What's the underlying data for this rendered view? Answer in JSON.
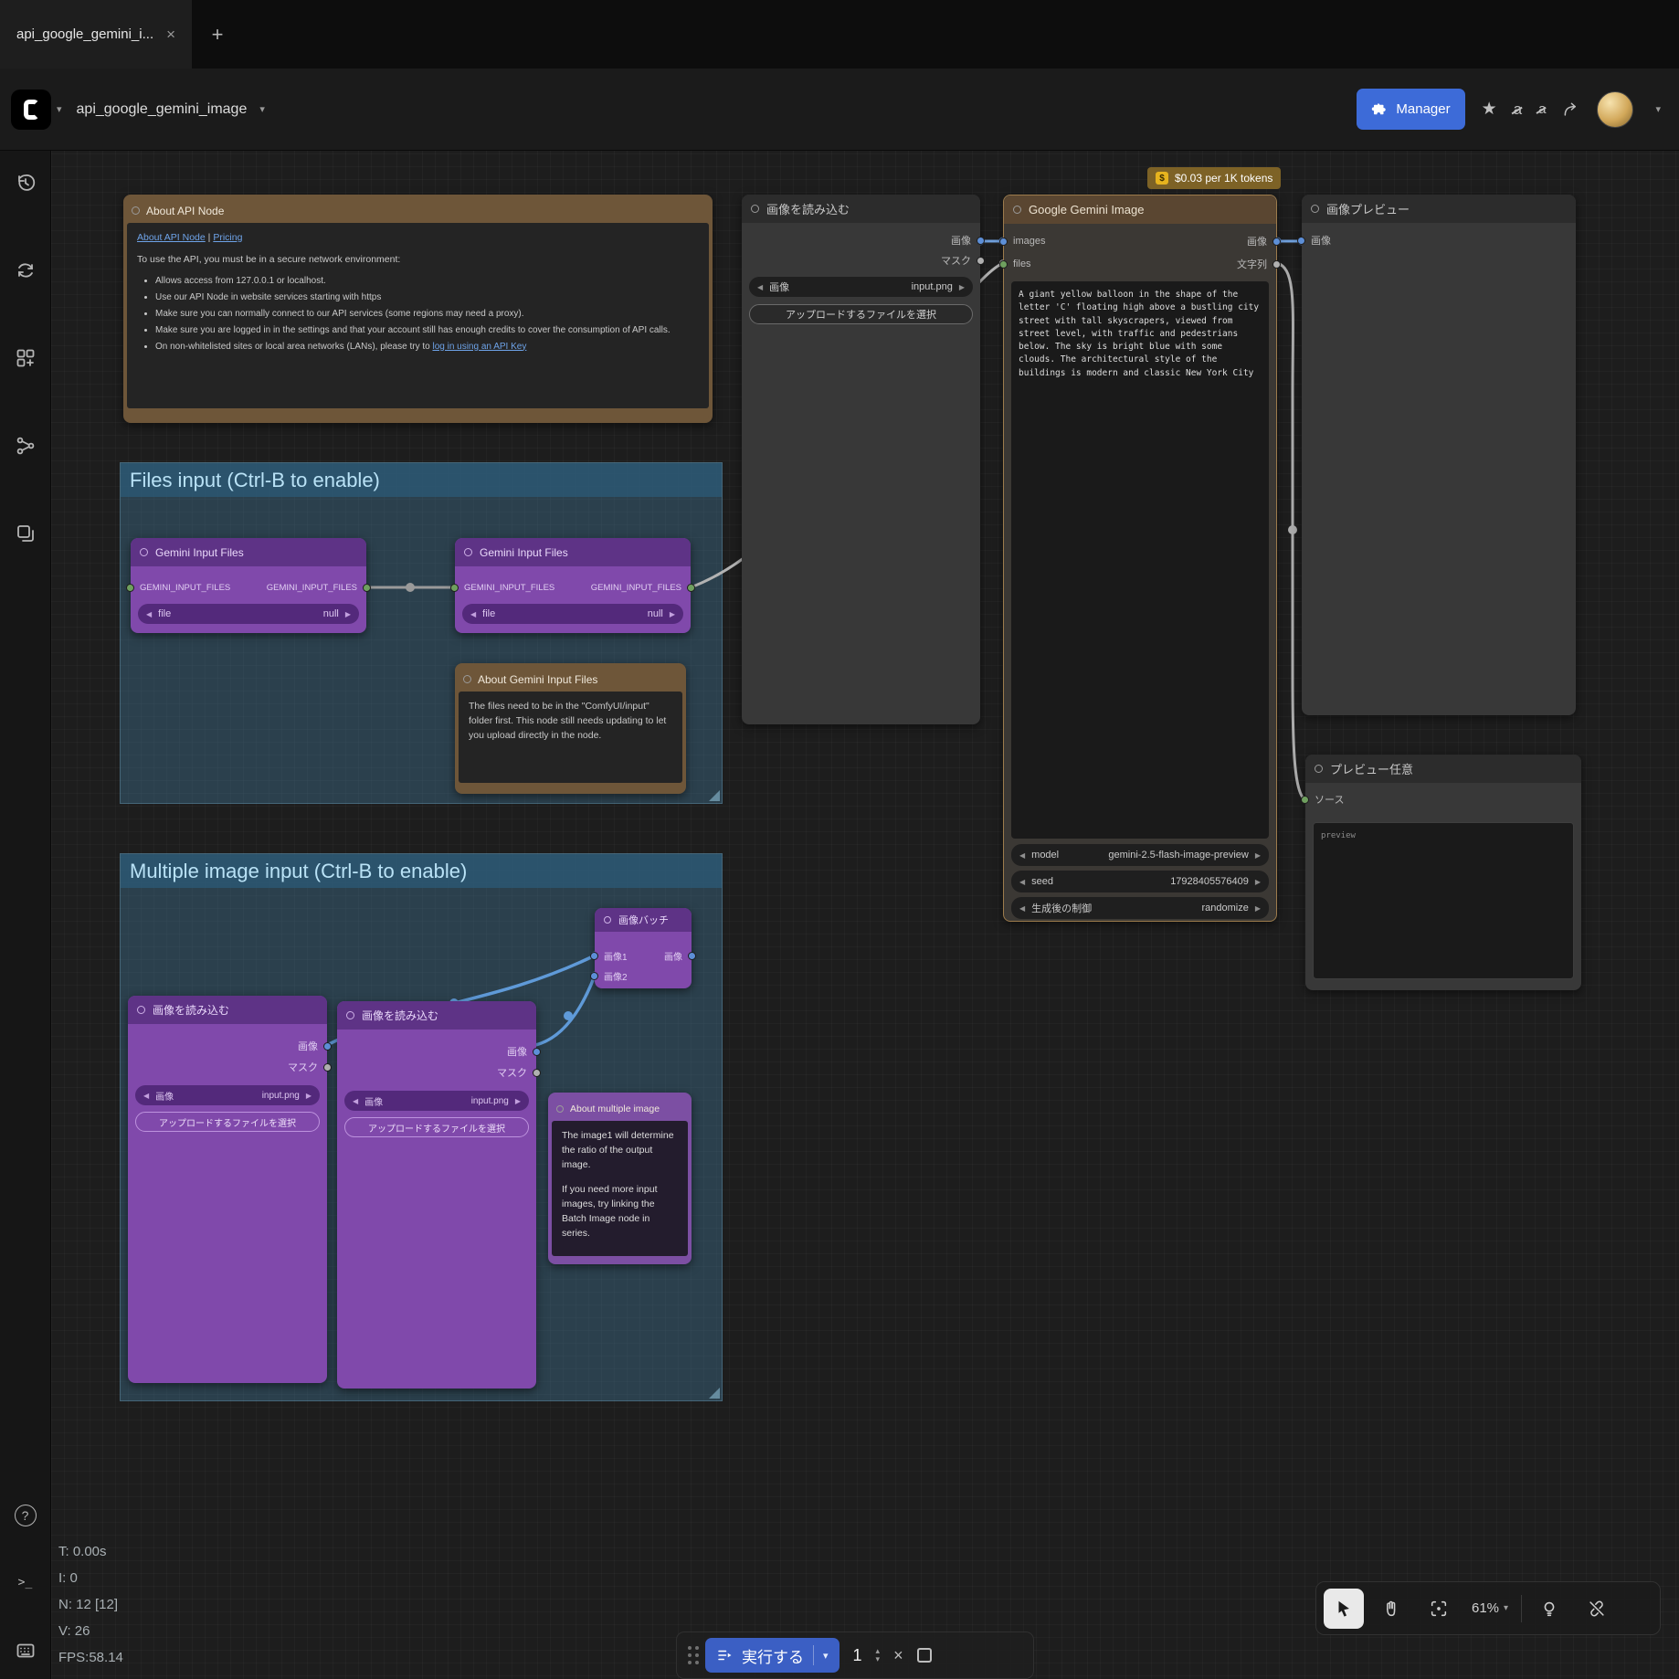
{
  "icons": {
    "close": "×",
    "plus": "+",
    "chevron": "▾",
    "up": "▴",
    "down": "▾",
    "left": "◀",
    "right": "▶",
    "star": "★",
    "lang_a": "a",
    "question": "?",
    "terminal": ">_",
    "pipe": "|",
    "dollar": "$"
  },
  "tab_bar": {
    "active_tab": "api_google_gemini_i..."
  },
  "header": {
    "workflow_title": "api_google_gemini_image",
    "manager": "Manager"
  },
  "canvas": {
    "cost_badge": "$0.03 per 1K tokens",
    "groups": {
      "files": "Files input (Ctrl-B to enable)",
      "multi": "Multiple image input (Ctrl-B to enable)"
    },
    "nodes": {
      "about_api": {
        "title": "About API Node",
        "link1": "About API Node",
        "link2": "Pricing",
        "intro": "To use the API, you must be in a secure network environment:",
        "bullets": [
          "Allows access from 127.0.0.1 or localhost.",
          "Use our API Node in website services starting with https",
          "Make sure you can normally connect to our API services (some regions may need a proxy).",
          "Make sure you are logged in in the settings and that your account still has enough credits to cover the consumption of API calls.",
          "On non-whitelisted sites or local area networks (LANs), please try to "
        ],
        "api_key_link": "log in using an API Key"
      },
      "gemini_files_1": {
        "title": "Gemini Input Files",
        "in": "GEMINI_INPUT_FILES",
        "out": "GEMINI_INPUT_FILES",
        "w_label": "file",
        "w_value": "null"
      },
      "gemini_files_2": {
        "title": "Gemini Input Files",
        "in": "GEMINI_INPUT_FILES",
        "out": "GEMINI_INPUT_FILES",
        "w_label": "file",
        "w_value": "null"
      },
      "about_gemini_files": {
        "title": "About Gemini Input Files",
        "text": "The files need to be in the \"ComfyUI/input\" folder first. This node still needs updating to let you upload directly in the node."
      },
      "load_image": {
        "title": "画像を読み込む",
        "out1": "画像",
        "out2": "マスク",
        "w_label": "画像",
        "w_value": "input.png",
        "upload": "アップロードするファイルを選択"
      },
      "gemini": {
        "title": "Google Gemini Image",
        "in1": "images",
        "in2": "files",
        "out1": "画像",
        "out2": "文字列",
        "prompt": "A giant yellow balloon in the shape of the letter 'C' floating high above a bustling city street with tall skyscrapers, viewed from street level, with traffic and pedestrians below. The sky is bright blue with some clouds. The architectural style of the buildings is modern and classic New York City",
        "w1_label": "model",
        "w1_value": "gemini-2.5-flash-image-preview",
        "w2_label": "seed",
        "w2_value": "17928405576409",
        "w3_label": "生成後の制御",
        "w3_value": "randomize"
      },
      "preview_image": {
        "title": "画像プレビュー",
        "in1": "画像"
      },
      "preview_any": {
        "title": "プレビュー任意",
        "in1": "ソース",
        "placeholder": "preview"
      },
      "load_image_a": {
        "title": "画像を読み込む",
        "out1": "画像",
        "out2": "マスク",
        "w_label": "画像",
        "w_value": "input.png",
        "upload": "アップロードするファイルを選択"
      },
      "load_image_b": {
        "title": "画像を読み込む",
        "out1": "画像",
        "out2": "マスク",
        "w_label": "画像",
        "w_value": "input.png",
        "upload": "アップロードするファイルを選択"
      },
      "image_batch": {
        "title": "画像バッチ",
        "in1": "画像1",
        "in2": "画像2",
        "out1": "画像"
      },
      "about_multi": {
        "title": "About multiple image",
        "p1": "The image1 will determine the ratio of the output image.",
        "p2": "If you need more input images, try linking the Batch Image node in series."
      }
    }
  },
  "stats": {
    "t": "T: 0.00s",
    "i": "I: 0",
    "n": "N: 12 [12]",
    "v": "V: 26",
    "fps": "FPS:58.14"
  },
  "action_bar": {
    "run": "実行する",
    "count": "1"
  },
  "zoom_toolbar": {
    "zoom": "61%"
  }
}
